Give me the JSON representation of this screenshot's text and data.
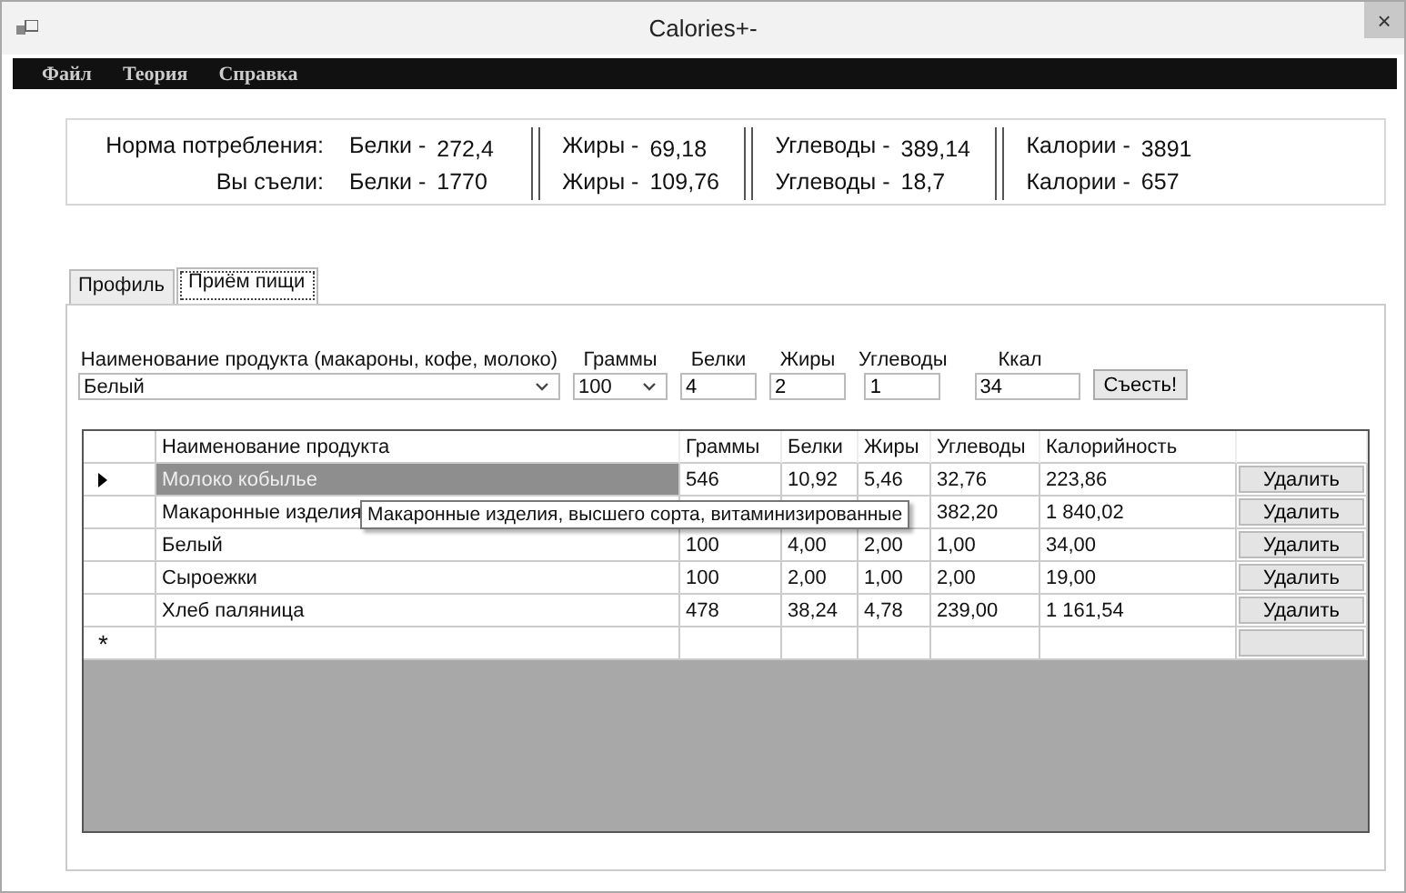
{
  "window": {
    "title": "Calories+-",
    "close": "×"
  },
  "menu": [
    "Файл",
    "Теория",
    "Справка"
  ],
  "summary": [
    {
      "label": "Норма потребления:",
      "items": [
        {
          "name": "Белки -",
          "value": "272,4"
        },
        {
          "name": "Жиры -",
          "value": "69,18"
        },
        {
          "name": "Углеводы -",
          "value": "389,14"
        },
        {
          "name": "Калории -",
          "value": "3891"
        }
      ]
    },
    {
      "label": "Вы съели:",
      "items": [
        {
          "name": "Белки -",
          "value": "1770"
        },
        {
          "name": "Жиры -",
          "value": "109,76"
        },
        {
          "name": "Углеводы -",
          "value": "18,7"
        },
        {
          "name": "Калории -",
          "value": "657"
        }
      ]
    }
  ],
  "tabs": [
    {
      "label": "Профиль",
      "selected": false
    },
    {
      "label": "Приём пищи",
      "selected": true
    }
  ],
  "form": {
    "product": {
      "label": "Наименование продукта (макароны, кофе, молоко)",
      "value": "Белый"
    },
    "grams": {
      "label": "Граммы",
      "value": "100"
    },
    "fields": [
      {
        "label": "Белки",
        "value": "4"
      },
      {
        "label": "Жиры",
        "value": "2"
      },
      {
        "label": "Углеводы",
        "value": "1"
      },
      {
        "label": "Ккал",
        "value": "34"
      }
    ],
    "submit": "Съесть!"
  },
  "table": {
    "columns": [
      "Наименование продукта",
      "Граммы",
      "Белки",
      "Жиры",
      "Углеводы",
      "Калорийность"
    ],
    "rows": [
      {
        "selected": true,
        "cells": [
          "Молоко кобылье",
          "546",
          "10,92",
          "5,46",
          "32,76",
          "223,86"
        ],
        "action": "Удалить"
      },
      {
        "selected": false,
        "cells": [
          "Макаронные изделия",
          null,
          null,
          null,
          "382,20",
          "1 840,02"
        ],
        "action": "Удалить"
      },
      {
        "selected": false,
        "cells": [
          "Белый",
          "100",
          "4,00",
          "2,00",
          "1,00",
          "34,00"
        ],
        "action": "Удалить"
      },
      {
        "selected": false,
        "cells": [
          "Сыроежки",
          "100",
          "2,00",
          "1,00",
          "2,00",
          "19,00"
        ],
        "action": "Удалить"
      },
      {
        "selected": false,
        "cells": [
          "Хлеб паляница",
          "478",
          "38,24",
          "4,78",
          "239,00",
          "1 161,54"
        ],
        "action": "Удалить"
      }
    ],
    "new_row_marker": "*"
  },
  "tooltip": "Макаронные изделия, высшего сорта, витаминизированные"
}
